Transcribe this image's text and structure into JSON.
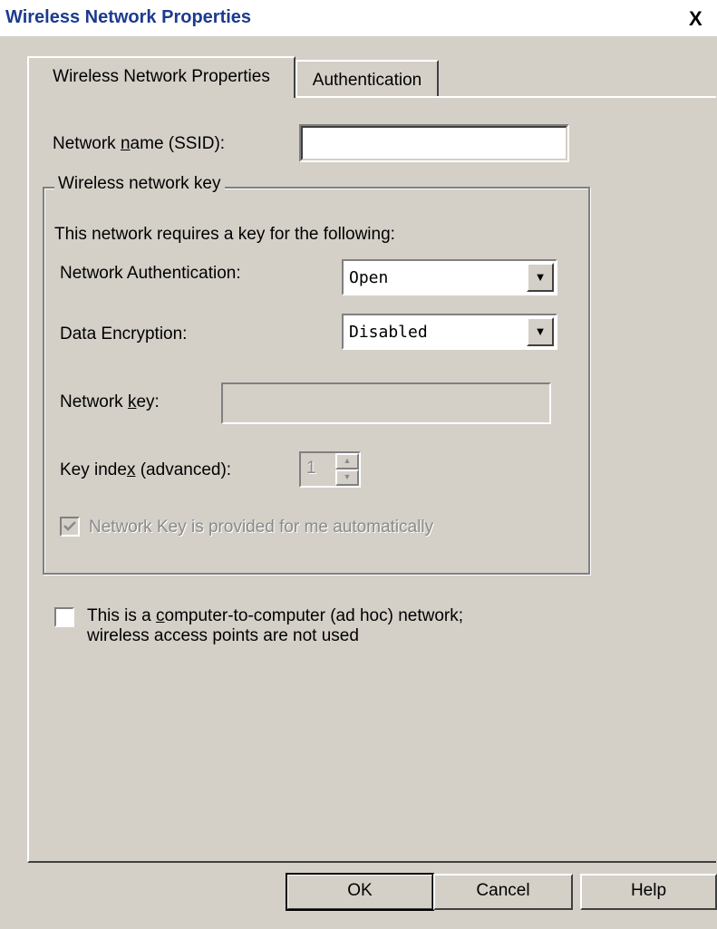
{
  "window": {
    "title": "Wireless Network Properties",
    "close_glyph": "X"
  },
  "tabs": [
    {
      "label": "Wireless Network Properties",
      "selected": true
    },
    {
      "label": "Authentication",
      "selected": false
    }
  ],
  "ssid": {
    "label_pre": "Network ",
    "label_mnemonic": "n",
    "label_post": "ame (SSID):",
    "value": ""
  },
  "key_group": {
    "legend": "Wireless network key",
    "description": "This network requires a key for the following:",
    "auth_label": "Network Authentication:",
    "auth_value": "Open",
    "encryption_label": "Data Encryption:",
    "encryption_value": "Disabled",
    "netkey_label_pre": "Network ",
    "netkey_label_mnemonic": "k",
    "netkey_label_post": "ey:",
    "netkey_value": "",
    "keyindex_label_pre": "Key inde",
    "keyindex_label_mnemonic": "x",
    "keyindex_label_post": " (advanced):",
    "keyindex_value": "1",
    "auto_key_label": "Network Key is provided for me automatically",
    "auto_key_checked": true
  },
  "adhoc": {
    "line1_pre": "This is a ",
    "line1_mnemonic": "c",
    "line1_post": "omputer-to-computer (ad hoc) network;",
    "line2": "wireless access points are not used",
    "checked": false
  },
  "buttons": {
    "ok": "OK",
    "cancel": "Cancel",
    "help": "Help"
  },
  "icons": {
    "dropdown": "chevron-down-icon",
    "spinner_up": "spin-up-icon",
    "spinner_down": "spin-down-icon",
    "checkmark": "checkmark-icon"
  }
}
